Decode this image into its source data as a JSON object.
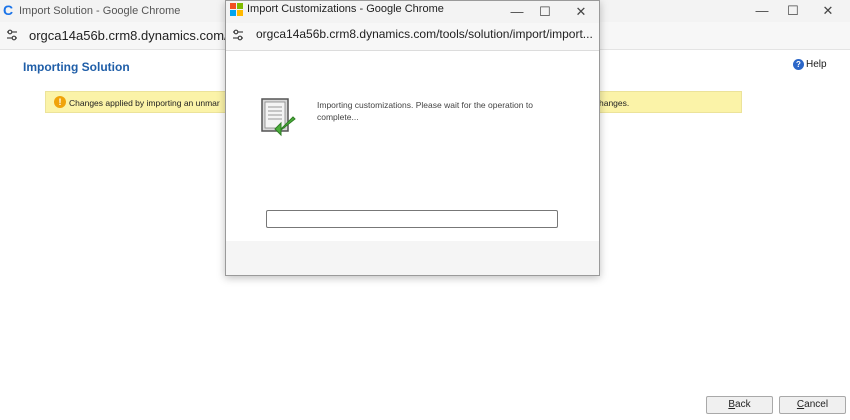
{
  "background_window": {
    "title": "Import Solution - Google Chrome",
    "url": "orgca14a56b.crm8.dynamics.com/tools/"
  },
  "page": {
    "title": "Importing Solution",
    "help_label": "Help",
    "warning_text": "Changes applied by importing an unmar",
    "warning_text_end": "hanges."
  },
  "buttons": {
    "back_prefix": "B",
    "back_rest": "ack",
    "cancel_prefix": "C",
    "cancel_rest": "ancel"
  },
  "popup": {
    "title": "Import Customizations - Google Chrome",
    "url": "orgca14a56b.crm8.dynamics.com/tools/solution/import/import...",
    "message": "Importing customizations. Please wait for the operation to complete...",
    "progress": 0
  },
  "colors": {
    "title_blue": "#1f5ea8",
    "warning_bg": "#fbf3a8",
    "warning_icon": "#f0a30a"
  }
}
